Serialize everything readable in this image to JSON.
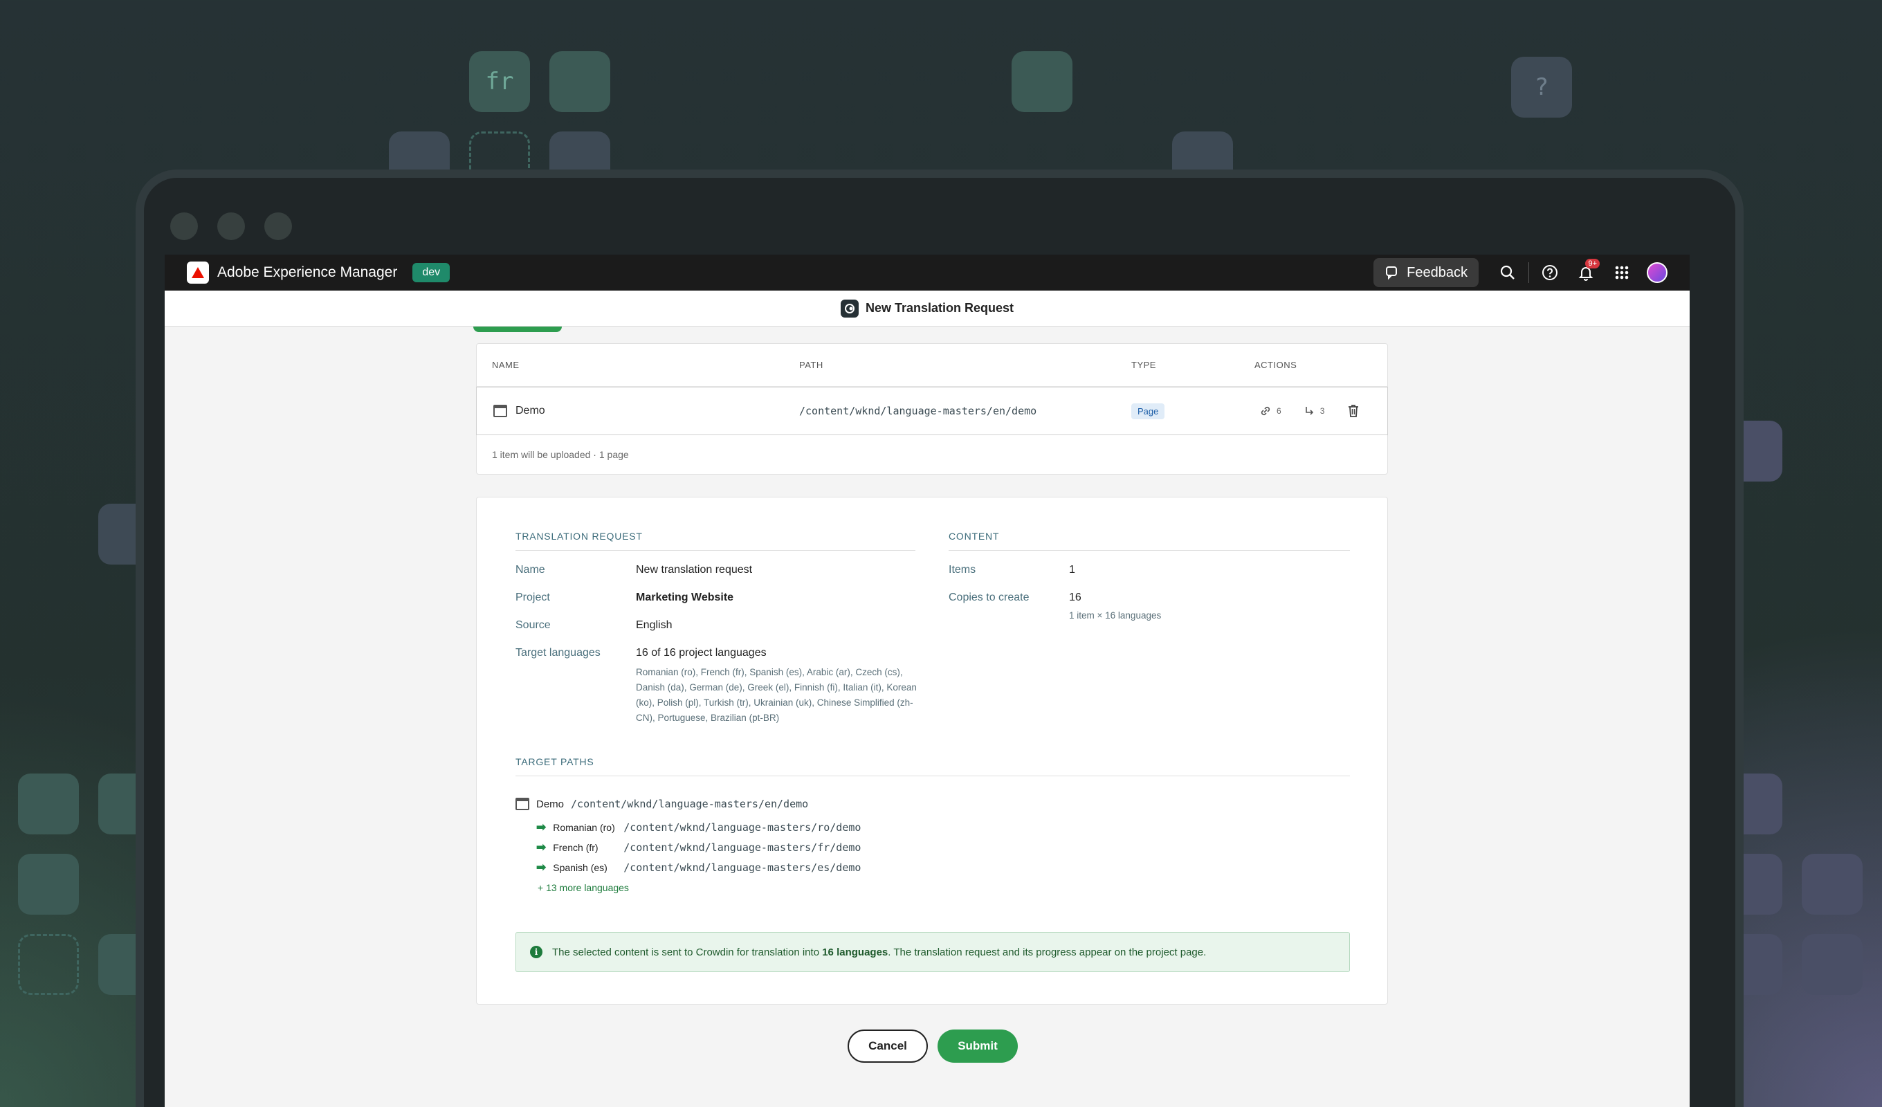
{
  "background_tiles": {
    "fr": "fr",
    "question": "?"
  },
  "topbar": {
    "app_name": "Adobe Experience Manager",
    "env_badge": "dev",
    "feedback_label": "Feedback",
    "notification_count": "9+"
  },
  "dialog": {
    "title": "New Translation Request"
  },
  "items_table": {
    "headers": {
      "name": "NAME",
      "path": "PATH",
      "type": "TYPE",
      "actions": "ACTIONS"
    },
    "rows": [
      {
        "name": "Demo",
        "path": "/content/wknd/language-masters/en/demo",
        "type": "Page",
        "links_count": "6",
        "refs_count": "3"
      }
    ],
    "footer": "1 item will be uploaded · 1 page"
  },
  "summary": {
    "translation_request_heading": "TRANSLATION REQUEST",
    "content_heading": "CONTENT",
    "name_label": "Name",
    "name_value": "New translation request",
    "project_label": "Project",
    "project_value": "Marketing Website",
    "source_label": "Source",
    "source_value": "English",
    "target_label": "Target languages",
    "target_value": "16 of 16 project languages",
    "target_list": "Romanian (ro), French (fr), Spanish (es), Arabic (ar), Czech (cs), Danish (da), German (de), Greek (el), Finnish (fi), Italian (it), Korean (ko), Polish (pl), Turkish (tr), Ukrainian (uk), Chinese Simplified (zh-CN), Portuguese, Brazilian (pt-BR)",
    "items_label": "Items",
    "items_value": "1",
    "copies_label": "Copies to create",
    "copies_value": "16",
    "copies_sub": "1 item × 16 languages"
  },
  "target_paths": {
    "heading": "TARGET PATHS",
    "source_name": "Demo",
    "source_path": "/content/wknd/language-masters/en/demo",
    "rows": [
      {
        "lang": "Romanian (ro)",
        "path": "/content/wknd/language-masters/ro/demo"
      },
      {
        "lang": "French (fr)",
        "path": "/content/wknd/language-masters/fr/demo"
      },
      {
        "lang": "Spanish (es)",
        "path": "/content/wknd/language-masters/es/demo"
      }
    ],
    "more_link": "+ 13 more languages"
  },
  "info": {
    "text_before": "The selected content is sent to Crowdin for translation into ",
    "text_bold": "16 languages",
    "text_after": ". The translation request and its progress appear on the project page."
  },
  "buttons": {
    "cancel": "Cancel",
    "submit": "Submit"
  }
}
